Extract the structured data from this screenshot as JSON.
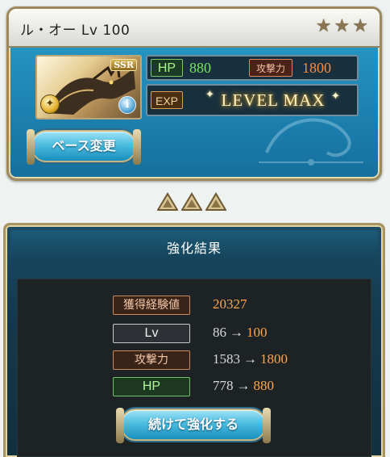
{
  "character": {
    "name": "ル・オー",
    "level_text": "Lv 100",
    "rarity": "SSR",
    "stars": [
      "★",
      "★",
      "★"
    ],
    "hp_label": "HP",
    "hp_value": "880",
    "atk_label": "攻撃力",
    "atk_value": "1800",
    "exp_label": "EXP",
    "exp_status": "LEVEL MAX",
    "element_icon": "light-element-icon",
    "info_icon": "info-icon"
  },
  "buttons": {
    "base_change": "ベース変更",
    "continue": "続けて強化する"
  },
  "results": {
    "title": "強化結果",
    "rows": [
      {
        "label": "獲得経験値",
        "value": "20327"
      },
      {
        "label": "Lv",
        "before": "86",
        "arrow": "→",
        "after": "100"
      },
      {
        "label": "攻撃力",
        "before": "1583",
        "arrow": "→",
        "after": "1800"
      },
      {
        "label": "HP",
        "before": "778",
        "arrow": "→",
        "after": "880"
      }
    ]
  },
  "colors": {
    "hp_green": "#78e35a",
    "atk_orange": "#ff8a3a",
    "panel_blue": "#1d84b4"
  }
}
